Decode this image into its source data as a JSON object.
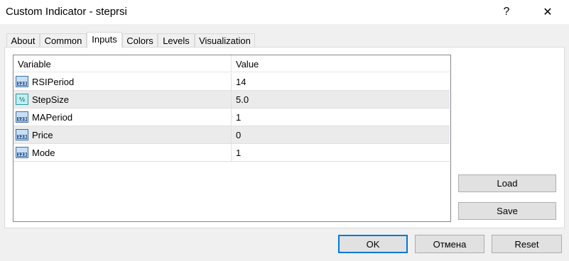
{
  "window": {
    "title": "Custom Indicator - steprsi",
    "help_glyph": "?",
    "close_glyph": "✕"
  },
  "tabs": [
    {
      "label": "About"
    },
    {
      "label": "Common"
    },
    {
      "label": "Inputs",
      "active": true
    },
    {
      "label": "Colors"
    },
    {
      "label": "Levels"
    },
    {
      "label": "Visualization"
    }
  ],
  "grid": {
    "columns": {
      "variable": "Variable",
      "value": "Value"
    },
    "rows": [
      {
        "name": "RSIPeriod",
        "value": "14",
        "type_icon": "integer-icon"
      },
      {
        "name": "StepSize",
        "value": "5.0",
        "type_icon": "double-icon"
      },
      {
        "name": "MAPeriod",
        "value": "1",
        "type_icon": "integer-icon"
      },
      {
        "name": "Price",
        "value": "0",
        "type_icon": "integer-icon"
      },
      {
        "name": "Mode",
        "value": "1",
        "type_icon": "integer-icon"
      }
    ]
  },
  "side_buttons": {
    "load": "Load",
    "save": "Save"
  },
  "footer_buttons": {
    "ok": "OK",
    "cancel": "Отмена",
    "reset": "Reset"
  },
  "colors": {
    "alt_row": "#ebebeb",
    "default_button_border": "#0078d7",
    "button_face": "#e1e1e1"
  }
}
